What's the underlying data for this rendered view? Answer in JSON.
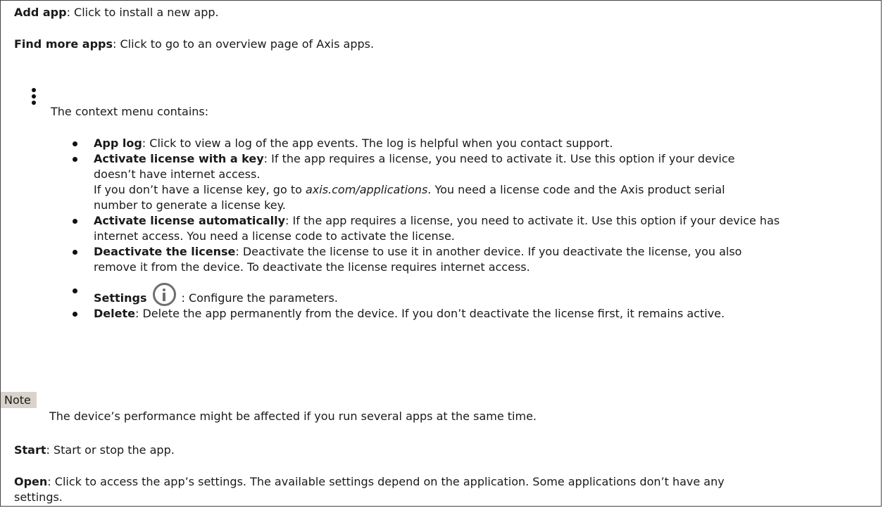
{
  "add_app": {
    "term": "Add app",
    "desc": ": Click to install a new app."
  },
  "find_more": {
    "term": "Find more apps",
    "desc": ": Click to go to an overview page of Axis apps."
  },
  "context_menu": {
    "icon": "kebab-menu-icon",
    "intro": "The context menu contains:",
    "items": [
      {
        "term": "App log",
        "lines": [
          ": Click to view a log of the app events. The log is helpful when you contact support."
        ]
      },
      {
        "term": "Activate license with a key",
        "lines": [
          ": If the app requires a license, you need to activate it. Use this option if your device",
          "doesn’t have internet access."
        ],
        "extra_pre": "If you don’t have a license key, go to ",
        "extra_link": "axis.com/applications",
        "extra_post": ". You need a license code and the Axis product serial",
        "extra_line2": "number to generate a license key."
      },
      {
        "term": "Activate license automatically",
        "lines": [
          ": If the app requires a license, you need to activate it. Use this option if your device has",
          "internet access. You need a license code to activate the license."
        ]
      },
      {
        "term": "Deactivate the license",
        "lines": [
          ": Deactivate the license to use it in another device. If you deactivate the license, you also",
          "remove it from the device. To deactivate the license requires internet access."
        ]
      },
      {
        "term": "Settings",
        "icon": "info-icon",
        "desc": ": Configure the parameters."
      },
      {
        "term": "Delete",
        "desc": ": Delete the app permanently from the device. If you don’t deactivate the license first, it remains active."
      }
    ]
  },
  "note": {
    "label": "Note",
    "text": "The device’s performance might be affected if you run several apps at the same time."
  },
  "start": {
    "term": "Start",
    "desc": ": Start or stop the app."
  },
  "open": {
    "term": "Open",
    "desc_line1": ": Click to access the app’s settings. The available settings depend on the application. Some applications don’t have any",
    "desc_line2": "settings."
  }
}
